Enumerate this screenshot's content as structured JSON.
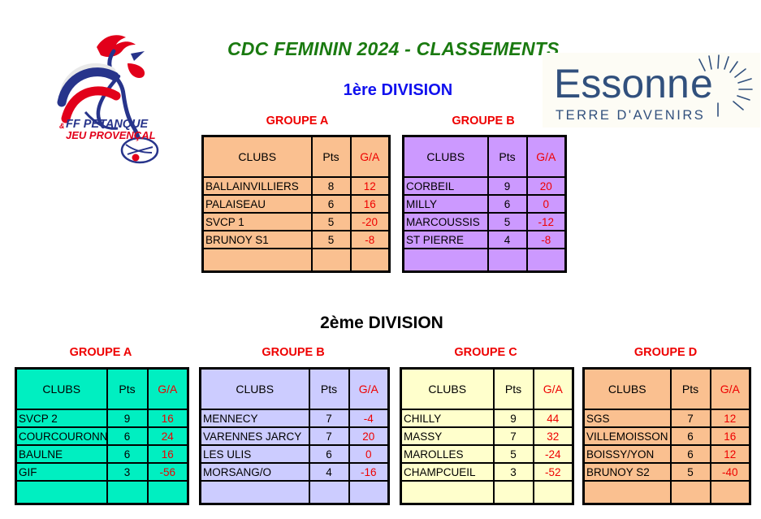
{
  "document": {
    "main_title": "CDC FEMININ 2024 - CLASSEMENTS",
    "title_color": "#1a7a10",
    "background": "#ffffff"
  },
  "logos": {
    "federation": {
      "name": "ffpjp-logo",
      "line1": "FF PETANQUE",
      "line2": "JEU PROVENÇAL",
      "ampersand": "&",
      "colors": {
        "blue": "#27348b",
        "red": "#e2001a",
        "white": "#ffffff"
      }
    },
    "department": {
      "name": "essonne-logo",
      "wordmark": "Essonne",
      "tagline": "TERRE D'AVENIRS",
      "color": "#31507d",
      "background": "#fdfcf5"
    }
  },
  "divisions": [
    {
      "id": "division-1",
      "title": "1ère DIVISION",
      "title_color": "#1111ee",
      "groups": [
        {
          "id": "d1-groupe-a",
          "caption": "GROUPE A",
          "caption_color": "#ee0000",
          "theme": "theme-orange",
          "fill": "#fac090",
          "headers": [
            "CLUBS",
            "Pts",
            "G/A"
          ],
          "rows": [
            {
              "club": "BALLAINVILLIERS",
              "pts": "8",
              "ga": "12"
            },
            {
              "club": "PALAISEAU",
              "pts": "6",
              "ga": "16"
            },
            {
              "club": "SVCP 1",
              "pts": "5",
              "ga": "-20"
            },
            {
              "club": "BRUNOY S1",
              "pts": "5",
              "ga": "-8"
            }
          ]
        },
        {
          "id": "d1-groupe-b",
          "caption": "GROUPE B",
          "caption_color": "#ee0000",
          "theme": "theme-purple",
          "fill": "#cc99ff",
          "headers": [
            "CLUBS",
            "Pts",
            "G/A"
          ],
          "rows": [
            {
              "club": "CORBEIL",
              "pts": "9",
              "ga": "20"
            },
            {
              "club": "MILLY",
              "pts": "6",
              "ga": "0"
            },
            {
              "club": "MARCOUSSIS",
              "pts": "5",
              "ga": "-12"
            },
            {
              "club": "ST PIERRE",
              "pts": "4",
              "ga": "-8"
            }
          ]
        }
      ]
    },
    {
      "id": "division-2",
      "title": "2ème DIVISION",
      "title_color": "#000000",
      "groups": [
        {
          "id": "d2-groupe-a",
          "caption": "GROUPE A",
          "caption_color": "#ee0000",
          "theme": "theme-teal",
          "fill": "#00efc1",
          "headers": [
            "CLUBS",
            "Pts",
            "G/A"
          ],
          "rows": [
            {
              "club": "SVCP 2",
              "pts": "9",
              "ga": "16"
            },
            {
              "club": "COURCOURONNES",
              "pts": "6",
              "ga": "24"
            },
            {
              "club": "BAULNE",
              "pts": "6",
              "ga": "16"
            },
            {
              "club": "GIF",
              "pts": "3",
              "ga": "-56"
            }
          ]
        },
        {
          "id": "d2-groupe-b",
          "caption": "GROUPE B",
          "caption_color": "#ee0000",
          "theme": "theme-blue",
          "fill": "#ccccff",
          "headers": [
            "CLUBS",
            "Pts",
            "G/A"
          ],
          "rows": [
            {
              "club": "MENNECY",
              "pts": "7",
              "ga": "-4"
            },
            {
              "club": "VARENNES JARCY",
              "pts": "7",
              "ga": "20"
            },
            {
              "club": "LES ULIS",
              "pts": "6",
              "ga": "0"
            },
            {
              "club": "MORSANG/O",
              "pts": "4",
              "ga": "-16"
            }
          ]
        },
        {
          "id": "d2-groupe-c",
          "caption": "GROUPE C",
          "caption_color": "#ee0000",
          "theme": "theme-yellow",
          "fill": "#ffffcc",
          "headers": [
            "CLUBS",
            "Pts",
            "G/A"
          ],
          "rows": [
            {
              "club": "CHILLY",
              "pts": "9",
              "ga": "44"
            },
            {
              "club": "MASSY",
              "pts": "7",
              "ga": "32"
            },
            {
              "club": "MAROLLES",
              "pts": "5",
              "ga": "-24"
            },
            {
              "club": "CHAMPCUEIL",
              "pts": "3",
              "ga": "-52"
            }
          ]
        },
        {
          "id": "d2-groupe-d",
          "caption": "GROUPE D",
          "caption_color": "#ee0000",
          "theme": "theme-orange",
          "fill": "#fac090",
          "headers": [
            "CLUBS",
            "Pts",
            "G/A"
          ],
          "rows": [
            {
              "club": "VILLEMOISSON",
              "pts": "6",
              "ga": "16"
            },
            {
              "club": "SGS",
              "pts": "7",
              "ga": "12"
            },
            {
              "club": "BOISSY/YON",
              "pts": "6",
              "ga": "12"
            },
            {
              "club": "BRUNOY S2",
              "pts": "5",
              "ga": "-40"
            }
          ],
          "rows_display": [
            {
              "club": "SGS",
              "pts": "7",
              "ga": "12"
            },
            {
              "club": "VILLEMOISSON",
              "pts": "6",
              "ga": "16"
            },
            {
              "club": "BOISSY/YON",
              "pts": "6",
              "ga": "12"
            },
            {
              "club": "BRUNOY S2",
              "pts": "5",
              "ga": "-40"
            }
          ]
        }
      ]
    }
  ]
}
